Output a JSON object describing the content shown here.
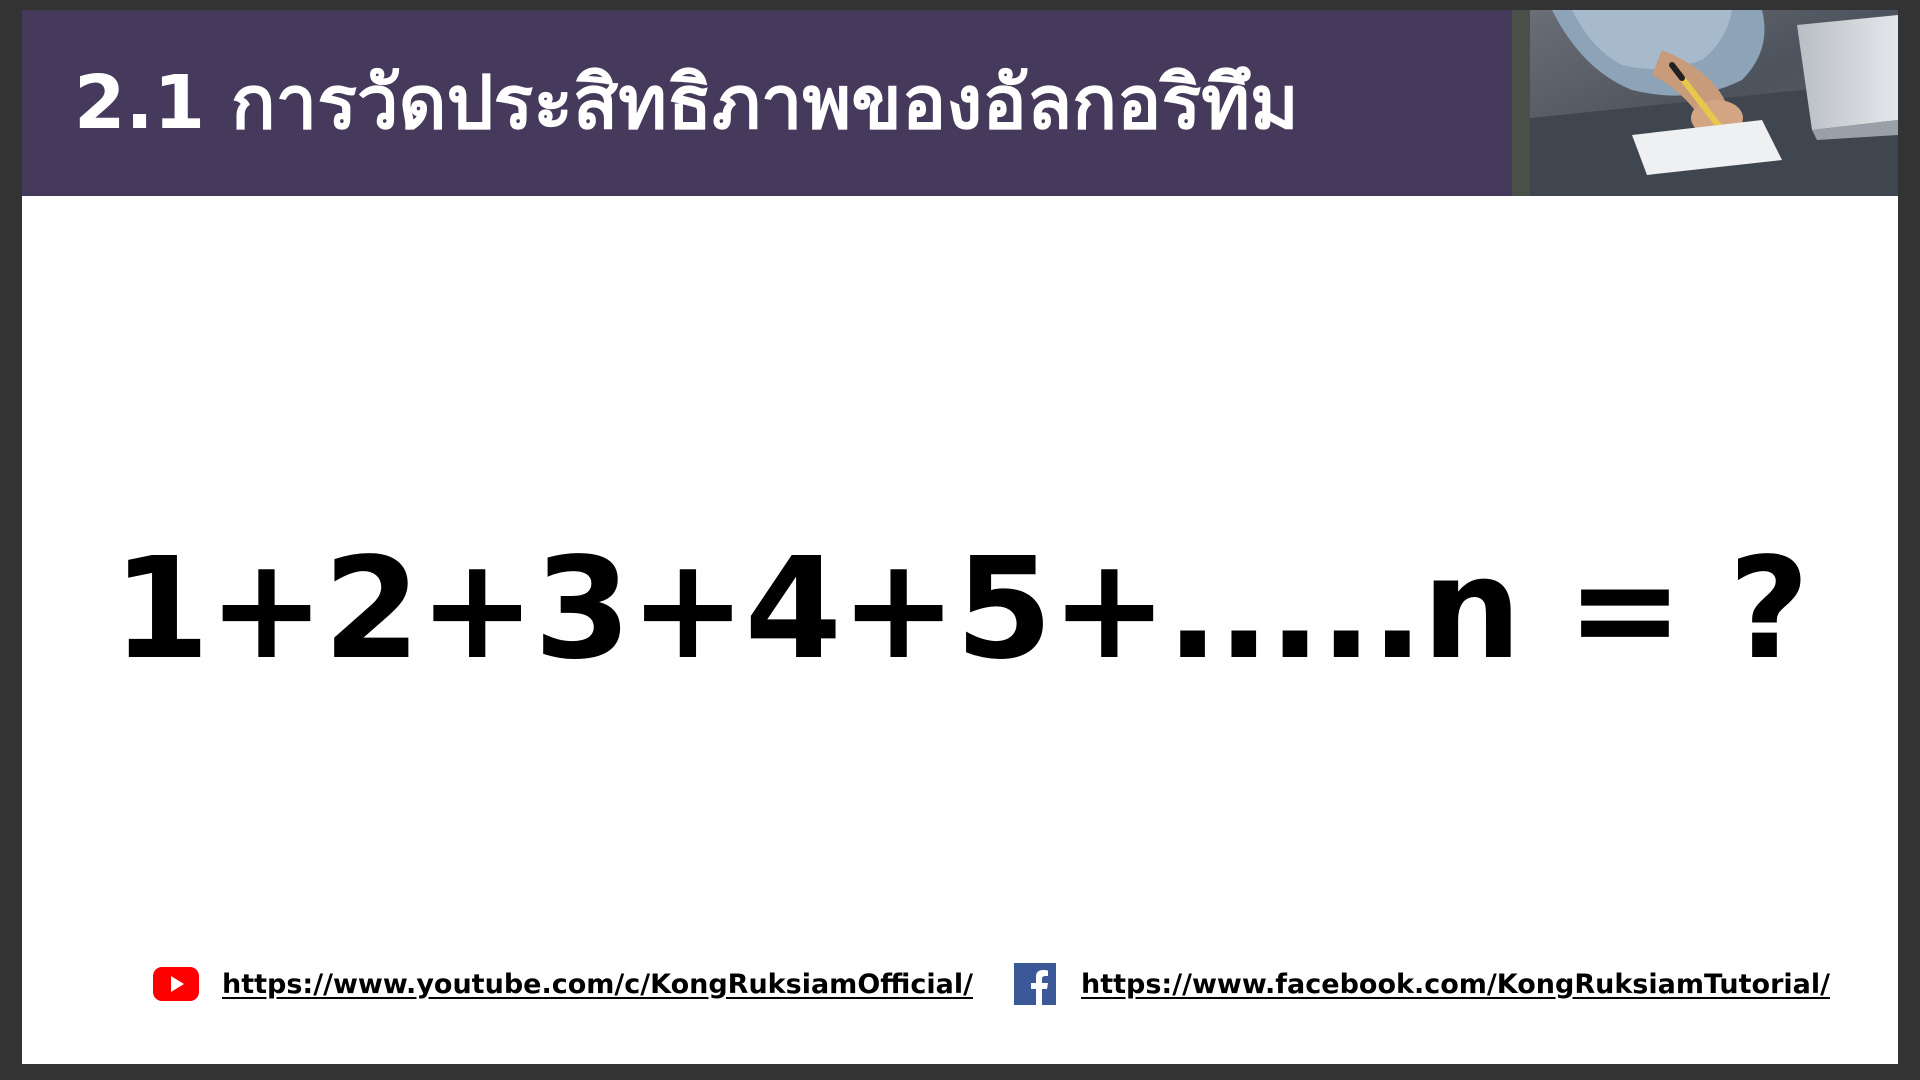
{
  "slide": {
    "title": "2.1 การวัดประสิทธิภาพของอัลกอริทึม",
    "formula": "1+2+3+4+5+.....n = ?",
    "header_image": "photo-person-writing-with-laptop"
  },
  "footer": {
    "youtube": {
      "icon": "youtube-icon",
      "url": "https://www.youtube.com/c/KongRuksiamOfficial/"
    },
    "facebook": {
      "icon": "facebook-icon",
      "url": "https://www.facebook.com/KongRuksiamTutorial/"
    }
  },
  "colors": {
    "title_bar": "#453a5c",
    "youtube_red": "#ff0000",
    "facebook_blue": "#3b5998",
    "text": "#000000",
    "background": "#ffffff",
    "frame": "#333333"
  }
}
